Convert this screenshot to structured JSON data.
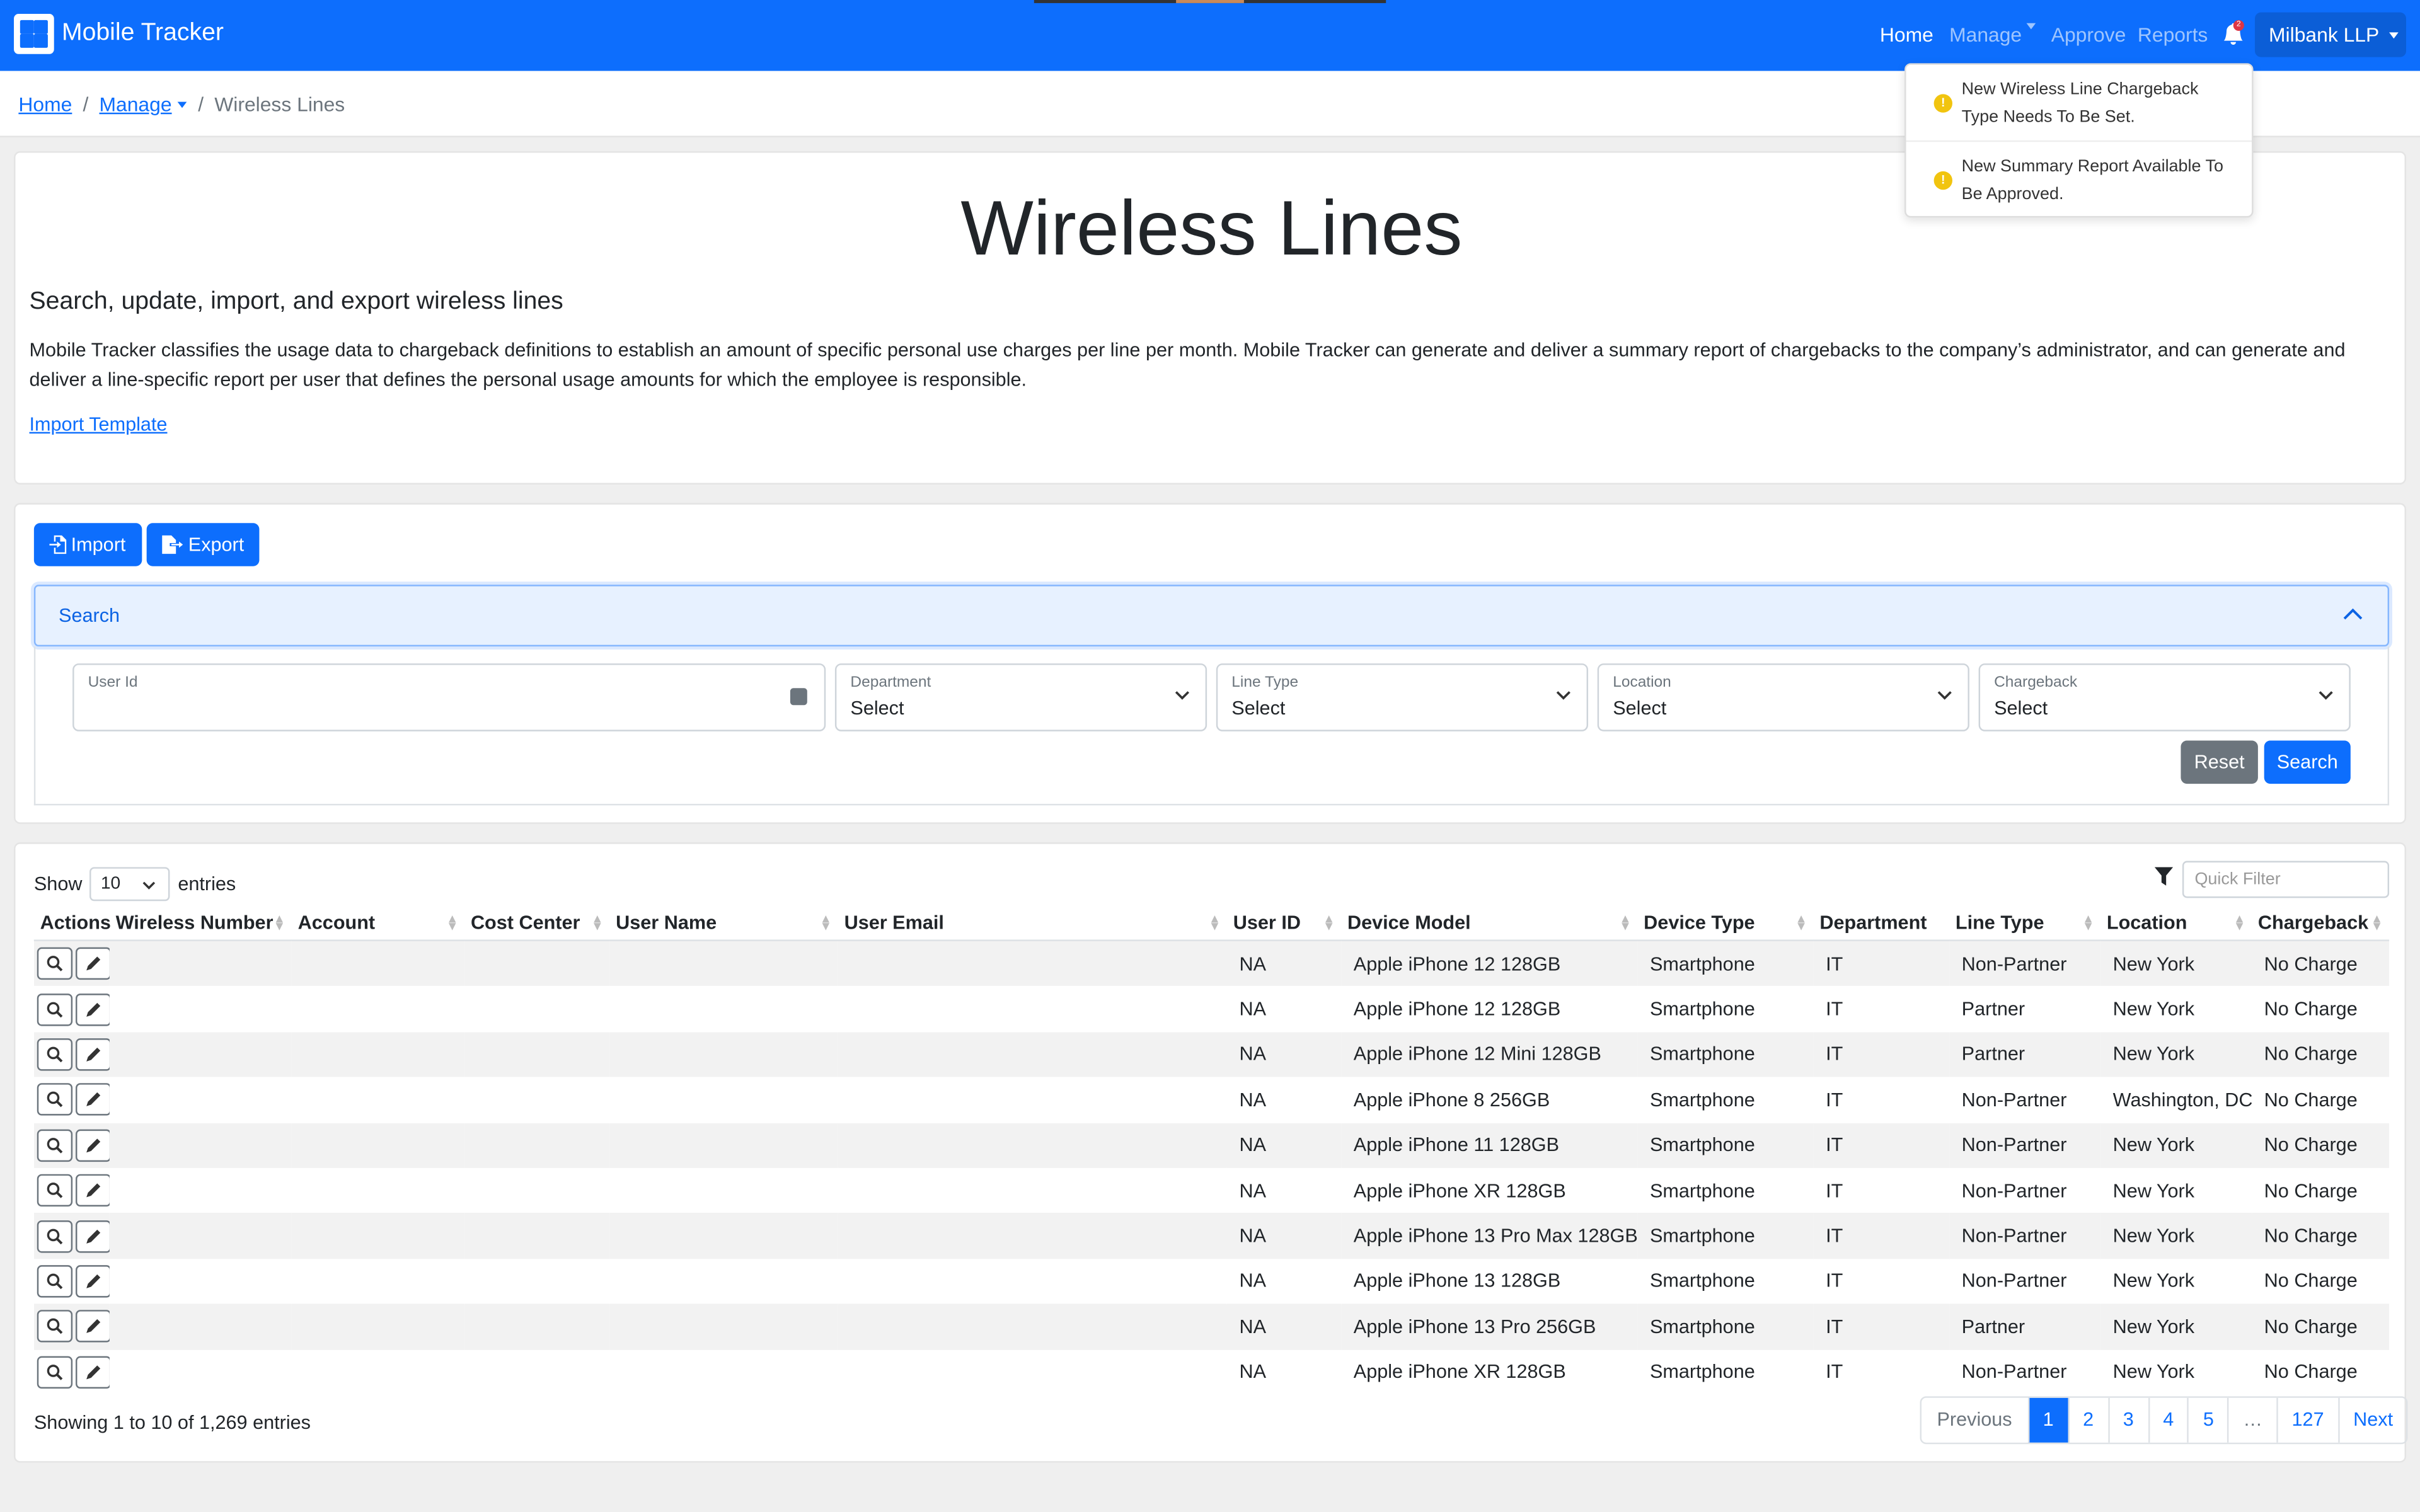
{
  "app": {
    "name": "Mobile Tracker"
  },
  "nav": {
    "home": "Home",
    "manage": "Manage",
    "approve": "Approve",
    "reports": "Reports",
    "account": "Milbank LLP",
    "notification_count": "2"
  },
  "breadcrumb": {
    "home": "Home",
    "manage": "Manage",
    "current": "Wireless Lines"
  },
  "notifications": [
    {
      "text": "New Wireless Line Chargeback Type Needs To Be Set."
    },
    {
      "text": "New Summary Report Available To Be Approved."
    }
  ],
  "header": {
    "title": "Wireless Lines",
    "subtitle": "Search, update, import, and export wireless lines",
    "description": "Mobile Tracker classifies the usage data to chargeback definitions to establish an amount of specific personal use charges per line per month. Mobile Tracker can generate and deliver a summary report of chargebacks to the company’s administrator, and can generate and deliver a line-specific report per user that defines the personal usage amounts for which the employee is responsible.",
    "import_template": "Import Template"
  },
  "toolbar": {
    "import": "Import",
    "export": "Export"
  },
  "search": {
    "header": "Search",
    "user_id_label": "User Id",
    "department_label": "Department",
    "line_type_label": "Line Type",
    "location_label": "Location",
    "chargeback_label": "Chargeback",
    "select": "Select",
    "reset": "Reset",
    "search": "Search"
  },
  "table": {
    "show": "Show",
    "page_size": "10",
    "entries": "entries",
    "quick_filter_placeholder": "Quick Filter",
    "columns": [
      "Actions",
      "Wireless Number",
      "Account",
      "Cost Center",
      "User Name",
      "User Email",
      "User ID",
      "Device Model",
      "Device Type",
      "Department",
      "Line Type",
      "Location",
      "Chargeback"
    ],
    "rows": [
      {
        "user_id": "NA",
        "device_model": "Apple iPhone 12 128GB",
        "device_type": "Smartphone",
        "department": "IT",
        "line_type": "Non-Partner",
        "location": "New York",
        "chargeback": "No Charge"
      },
      {
        "user_id": "NA",
        "device_model": "Apple iPhone 12 128GB",
        "device_type": "Smartphone",
        "department": "IT",
        "line_type": "Partner",
        "location": "New York",
        "chargeback": "No Charge"
      },
      {
        "user_id": "NA",
        "device_model": "Apple iPhone 12 Mini 128GB",
        "device_type": "Smartphone",
        "department": "IT",
        "line_type": "Partner",
        "location": "New York",
        "chargeback": "No Charge"
      },
      {
        "user_id": "NA",
        "device_model": "Apple iPhone 8 256GB",
        "device_type": "Smartphone",
        "department": "IT",
        "line_type": "Non-Partner",
        "location": "Washington, DC",
        "chargeback": "No Charge"
      },
      {
        "user_id": "NA",
        "device_model": "Apple iPhone 11 128GB",
        "device_type": "Smartphone",
        "department": "IT",
        "line_type": "Non-Partner",
        "location": "New York",
        "chargeback": "No Charge"
      },
      {
        "user_id": "NA",
        "device_model": "Apple iPhone XR 128GB",
        "device_type": "Smartphone",
        "department": "IT",
        "line_type": "Non-Partner",
        "location": "New York",
        "chargeback": "No Charge"
      },
      {
        "user_id": "NA",
        "device_model": "Apple iPhone 13 Pro Max 128GB",
        "device_type": "Smartphone",
        "department": "IT",
        "line_type": "Non-Partner",
        "location": "New York",
        "chargeback": "No Charge"
      },
      {
        "user_id": "NA",
        "device_model": "Apple iPhone 13 128GB",
        "device_type": "Smartphone",
        "department": "IT",
        "line_type": "Non-Partner",
        "location": "New York",
        "chargeback": "No Charge"
      },
      {
        "user_id": "NA",
        "device_model": "Apple iPhone 13 Pro 256GB",
        "device_type": "Smartphone",
        "department": "IT",
        "line_type": "Partner",
        "location": "New York",
        "chargeback": "No Charge"
      },
      {
        "user_id": "NA",
        "device_model": "Apple iPhone XR 128GB",
        "device_type": "Smartphone",
        "department": "IT",
        "line_type": "Non-Partner",
        "location": "New York",
        "chargeback": "No Charge"
      }
    ],
    "showing": "Showing 1 to 10 of 1,269 entries"
  },
  "pagination": {
    "previous": "Previous",
    "pages": [
      "1",
      "2",
      "3",
      "4",
      "5",
      "…",
      "127"
    ],
    "next": "Next",
    "active": "1"
  },
  "colors": {
    "primary": "#0d6efd",
    "secondary": "#6c757d",
    "warning": "#f1c40f",
    "danger": "#dc3545"
  }
}
